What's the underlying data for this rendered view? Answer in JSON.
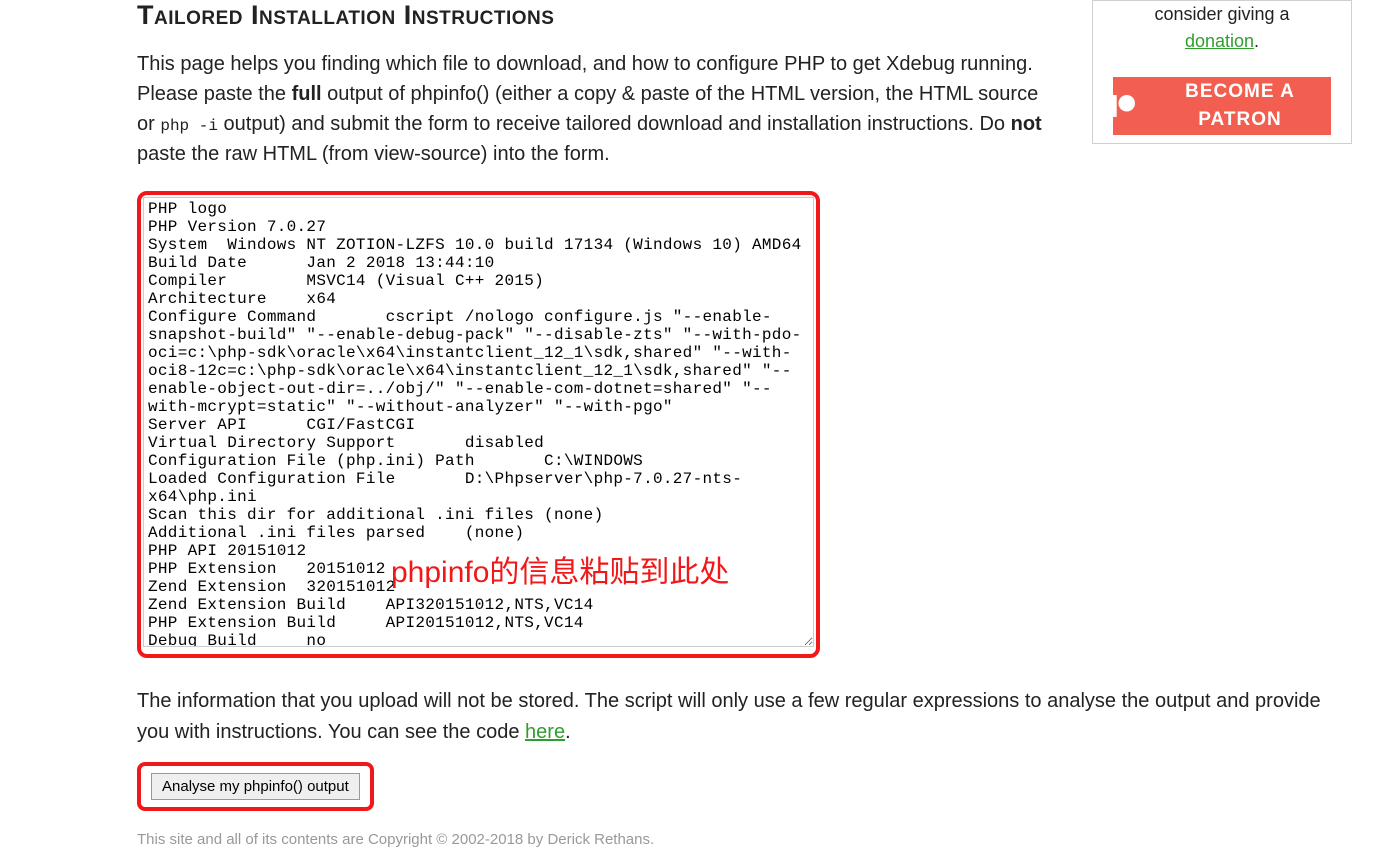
{
  "heading": "Tailored Installation Instructions",
  "intro_parts": {
    "p1": "This page helps you finding which file to download, and how to configure PHP to get Xdebug running. Please paste the ",
    "p2_bold": "full",
    "p3": " output of phpinfo() (either a copy & paste of the HTML version, the HTML source or ",
    "p4_code": "php -i",
    "p5": " output) and submit the form to receive tailored download and installation instructions. Do ",
    "p6_bold": "not",
    "p7": " paste the raw HTML (from view-source) into the form."
  },
  "textarea_value": "PHP logo\nPHP Version 7.0.27\nSystem  Windows NT ZOTION-LZFS 10.0 build 17134 (Windows 10) AMD64\nBuild Date      Jan 2 2018 13:44:10\nCompiler        MSVC14 (Visual C++ 2015)\nArchitecture    x64\nConfigure Command       cscript /nologo configure.js \"--enable-snapshot-build\" \"--enable-debug-pack\" \"--disable-zts\" \"--with-pdo-oci=c:\\php-sdk\\oracle\\x64\\instantclient_12_1\\sdk,shared\" \"--with-oci8-12c=c:\\php-sdk\\oracle\\x64\\instantclient_12_1\\sdk,shared\" \"--enable-object-out-dir=../obj/\" \"--enable-com-dotnet=shared\" \"--with-mcrypt=static\" \"--without-analyzer\" \"--with-pgo\"\nServer API      CGI/FastCGI\nVirtual Directory Support       disabled\nConfiguration File (php.ini) Path       C:\\WINDOWS\nLoaded Configuration File       D:\\Phpserver\\php-7.0.27-nts-x64\\php.ini\nScan this dir for additional .ini files (none)\nAdditional .ini files parsed    (none)\nPHP API 20151012\nPHP Extension   20151012\nZend Extension  320151012\nZend Extension Build    API320151012,NTS,VC14\nPHP Extension Build     API20151012,NTS,VC14\nDebug Build     no",
  "overlay_annotation_zh": "phpinfo的信息粘贴到此处",
  "note": {
    "a": "The information that you upload will not be stored. The script will only use a few regular expressions to analyse the output and provide you with instructions. You can see the code ",
    "link": "here",
    "b": "."
  },
  "analyse_button_label": "Analyse my phpinfo() output",
  "footer_text": "This site and all of its contents are Copyright © 2002-2018 by Derick Rethans.",
  "sidebar": {
    "line1": "consider giving a",
    "donation_link": "donation",
    "period": ".",
    "patreon_label": "BECOME A PATRON"
  }
}
